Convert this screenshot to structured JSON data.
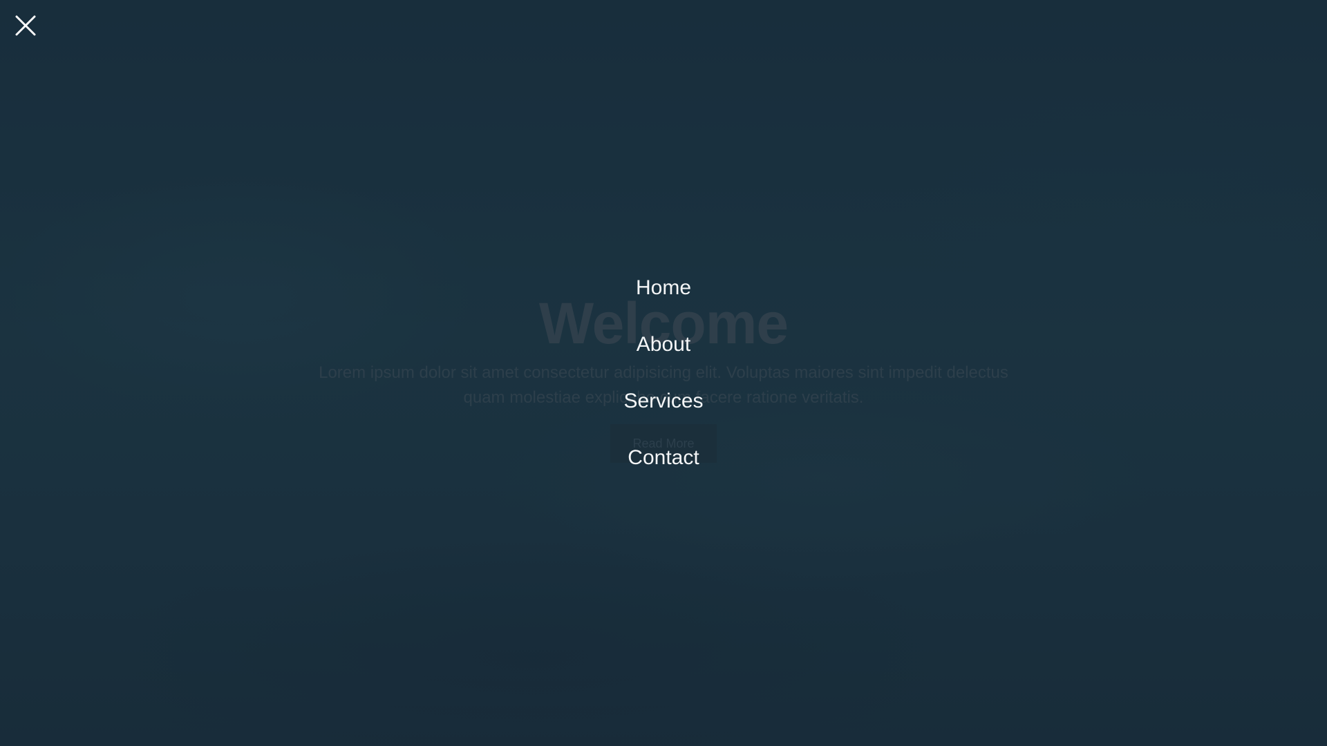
{
  "hero": {
    "title": "Welcome",
    "text": "Lorem ipsum dolor sit amet consectetur adipisicing elit. Voluptas maiores sint impedit delectus quam molestiae explicabo cum facere ratione veritatis.",
    "button_label": "Read More"
  },
  "menu": {
    "close_icon": "close-icon",
    "items": [
      {
        "label": "Home"
      },
      {
        "label": "About"
      },
      {
        "label": "Services"
      },
      {
        "label": "Contact"
      }
    ]
  },
  "colors": {
    "background": "#1c3441",
    "menu_text": "#f4f6f7",
    "dimmed_text": "#44555f"
  }
}
